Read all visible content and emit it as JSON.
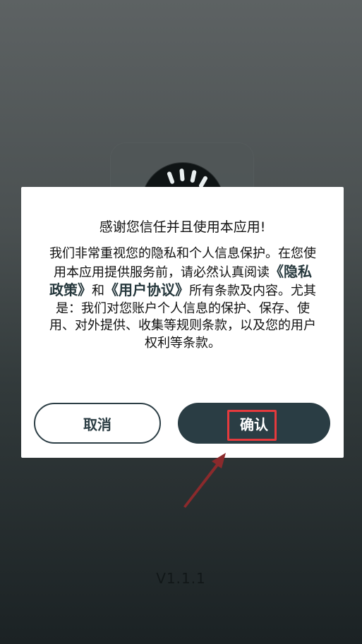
{
  "background": {
    "version": "V1.1.1"
  },
  "dialog": {
    "title": "感谢您信任并且使用本应用!",
    "body_line1": "我们非常重视您的隐私和个人信息保护。在您使用本应用提供服务前，请必然认真阅读",
    "privacy_link": "《隐私政策》",
    "and_text": "和",
    "agreement_link": "《用户协议》",
    "body_line2": "所有条款及内容。尤其是：我们对您账户个人信息的保护、保存、使用、对外提供、收集等规则条款，以及您的用户权利等条款。",
    "cancel_label": "取消",
    "confirm_label": "确认"
  },
  "colors": {
    "accent": "#2a3d44",
    "highlight": "#e53a3d",
    "arrow": "#8b2a2c"
  },
  "icons": {
    "app_logo": "app-logo-icon",
    "annotation_arrow": "arrow-icon"
  }
}
